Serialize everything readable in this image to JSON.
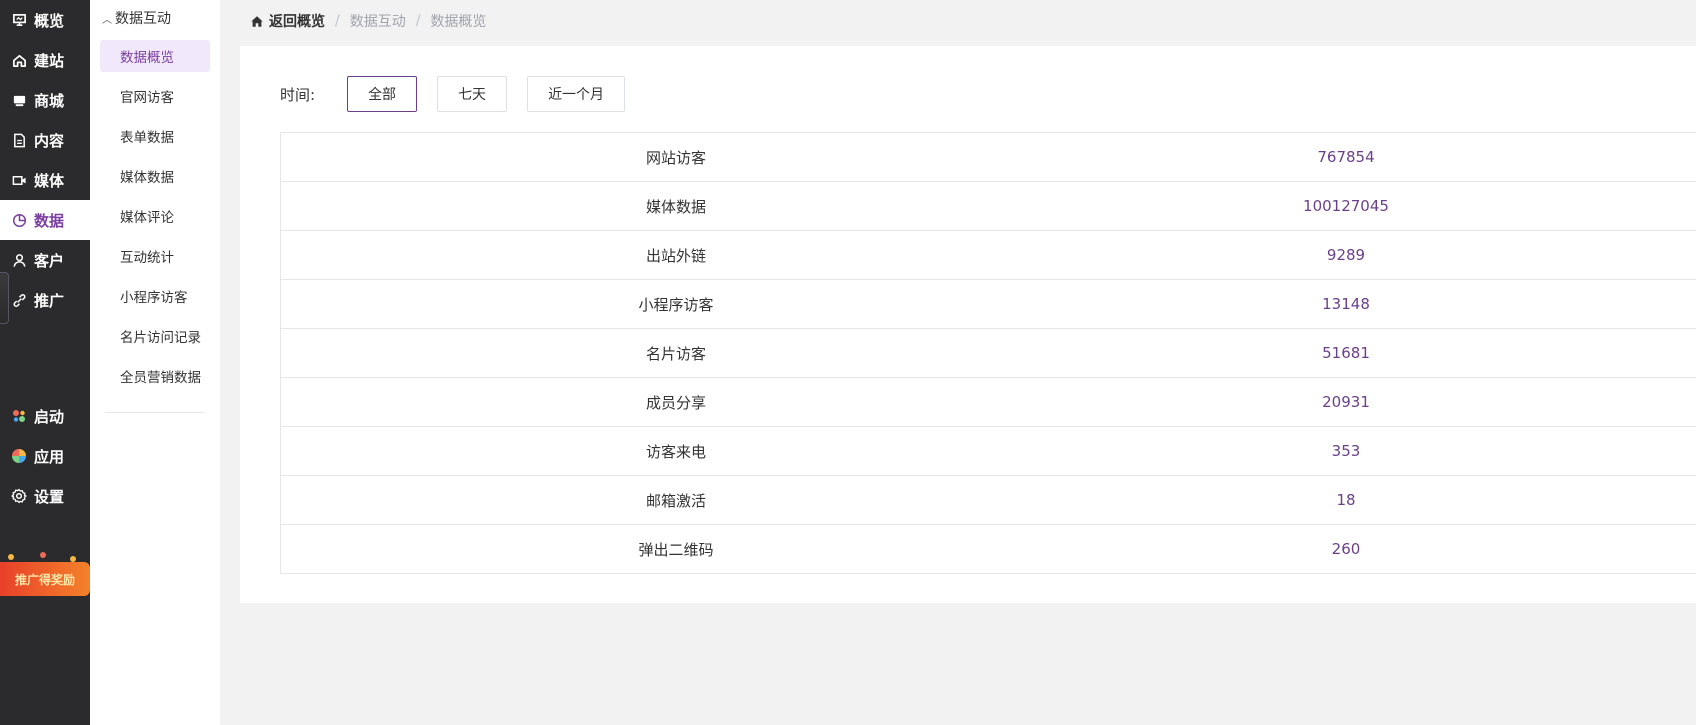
{
  "nav": {
    "top_items": [
      {
        "label": "概览",
        "icon": "dashboard-icon"
      },
      {
        "label": "建站",
        "icon": "home-icon"
      },
      {
        "label": "商城",
        "icon": "shop-icon"
      },
      {
        "label": "内容",
        "icon": "document-icon"
      },
      {
        "label": "媒体",
        "icon": "video-icon"
      },
      {
        "label": "数据",
        "icon": "chart-pie-icon",
        "active": true
      },
      {
        "label": "客户",
        "icon": "user-icon"
      },
      {
        "label": "推广",
        "icon": "link-icon"
      }
    ],
    "bottom_items": [
      {
        "label": "启动",
        "icon": "launch-icon"
      },
      {
        "label": "应用",
        "icon": "apps-icon"
      },
      {
        "label": "设置",
        "icon": "gear-icon"
      }
    ],
    "promo": {
      "label": "推广得奖励"
    }
  },
  "submenu": {
    "group_title": "数据互动",
    "items": [
      {
        "label": "数据概览",
        "active": true
      },
      {
        "label": "官网访客"
      },
      {
        "label": "表单数据"
      },
      {
        "label": "媒体数据"
      },
      {
        "label": "媒体评论"
      },
      {
        "label": "互动统计"
      },
      {
        "label": "小程序访客"
      },
      {
        "label": "名片访问记录"
      },
      {
        "label": "全员营销数据"
      }
    ]
  },
  "breadcrumb": {
    "home": "返回概览",
    "items": [
      "数据互动",
      "数据概览"
    ]
  },
  "filter": {
    "label": "时间:",
    "options": [
      "全部",
      "七天",
      "近一个月"
    ],
    "selected": "全部"
  },
  "stats": [
    {
      "label": "网站访客",
      "value": "767854"
    },
    {
      "label": "媒体数据",
      "value": "100127045"
    },
    {
      "label": "出站外链",
      "value": "9289"
    },
    {
      "label": "小程序访客",
      "value": "13148"
    },
    {
      "label": "名片访客",
      "value": "51681"
    },
    {
      "label": "成员分享",
      "value": "20931"
    },
    {
      "label": "访客来电",
      "value": "353"
    },
    {
      "label": "邮箱激活",
      "value": "18"
    },
    {
      "label": "弹出二维码",
      "value": "260"
    }
  ],
  "colors": {
    "nav_bg": "#2b2b2d",
    "accent": "#7b3fa0",
    "value_color": "#6b3f8a",
    "active_sub_bg": "#f1e9fb"
  }
}
